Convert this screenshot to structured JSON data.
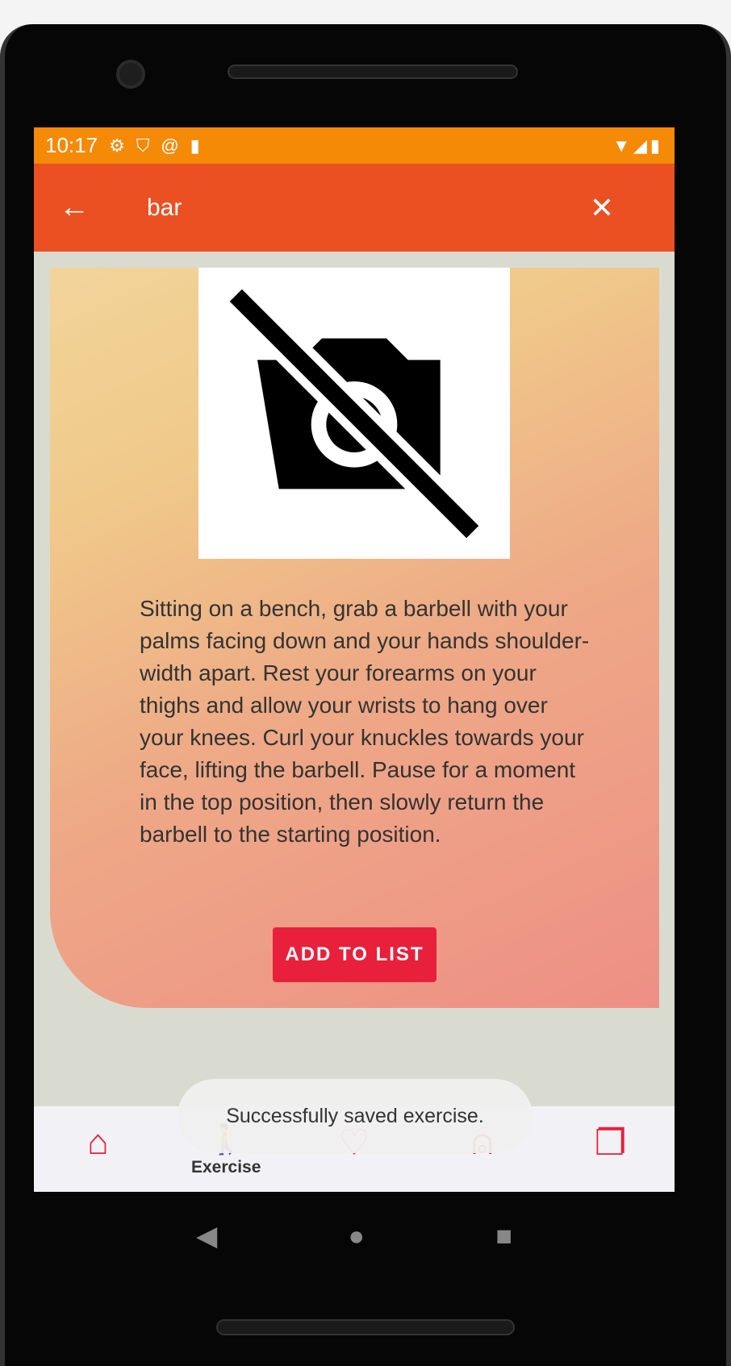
{
  "status": {
    "time": "10:17",
    "icons": [
      "gear-icon",
      "shield-play-icon",
      "at-icon",
      "sd-card-icon"
    ],
    "right_icons": [
      "wifi-icon",
      "signal-icon",
      "battery-icon"
    ]
  },
  "appbar": {
    "query": "bar"
  },
  "exercise": {
    "image": "no-photo-icon",
    "description": "Sitting on a bench, grab a barbell with your palms facing down and your hands shoulder-width apart. Rest your forearms on your thighs and allow your wrists to hang over your knees. Curl your knuckles towards your face, lifting the barbell. Pause for a moment in the top position, then slowly return the barbell to the starting position.",
    "add_label": "ADD TO LIST"
  },
  "toast": "Successfully saved exercise.",
  "nav": [
    {
      "icon": "home-icon"
    },
    {
      "icon": "exercise-icon",
      "label": "Exercise"
    },
    {
      "icon": "apple-icon"
    },
    {
      "icon": "profile-icon"
    },
    {
      "icon": "cards-icon"
    }
  ],
  "colors": {
    "status": "#f58a07",
    "appbar": "#eb5022",
    "accent": "#e8203c"
  }
}
